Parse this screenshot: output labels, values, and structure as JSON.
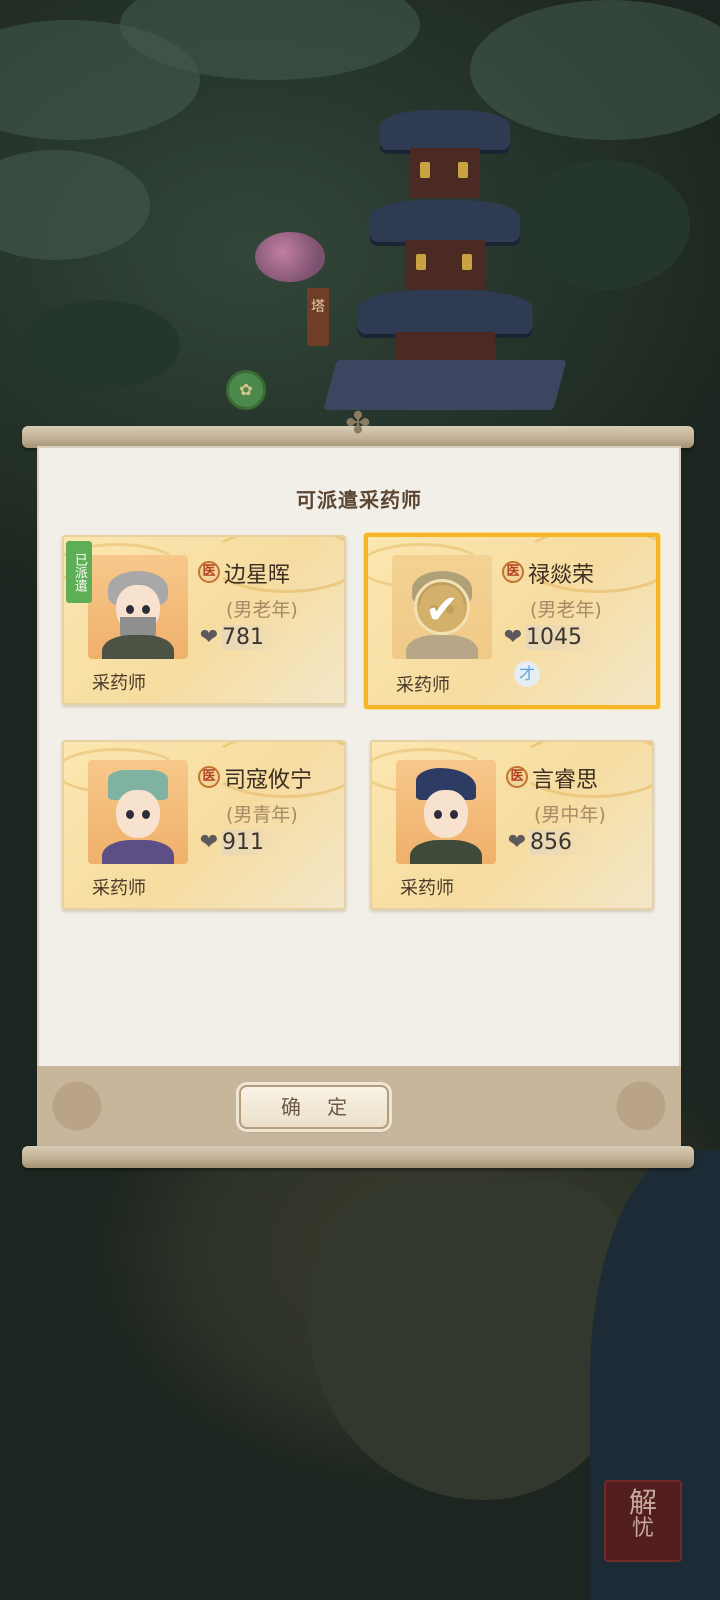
{
  "map": {
    "pagoda_sign": "塔",
    "corner_seal": "解忧"
  },
  "dialog": {
    "title": "可派遣采药师",
    "confirm_label": "确 定"
  },
  "herbalists": [
    {
      "name": "边星晖",
      "profession_icon": "医",
      "meta": "(男老年)",
      "stat": "781",
      "role": "采药师",
      "status": "已派遣",
      "selected": false,
      "talent": ""
    },
    {
      "name": "禄燚荣",
      "profession_icon": "医",
      "meta": "(男老年)",
      "stat": "1045",
      "role": "采药师",
      "status": "",
      "selected": true,
      "talent": "才"
    },
    {
      "name": "司寇攸宁",
      "profession_icon": "医",
      "meta": "(男青年)",
      "stat": "911",
      "role": "采药师",
      "status": "",
      "selected": false,
      "talent": ""
    },
    {
      "name": "言睿思",
      "profession_icon": "医",
      "meta": "(男中年)",
      "stat": "856",
      "role": "采药师",
      "status": "",
      "selected": false,
      "talent": ""
    }
  ],
  "colors": {
    "selected_border": "#f4b526",
    "dispatched_tag": "#5dae55",
    "panel_bg": "#f2efe9"
  }
}
